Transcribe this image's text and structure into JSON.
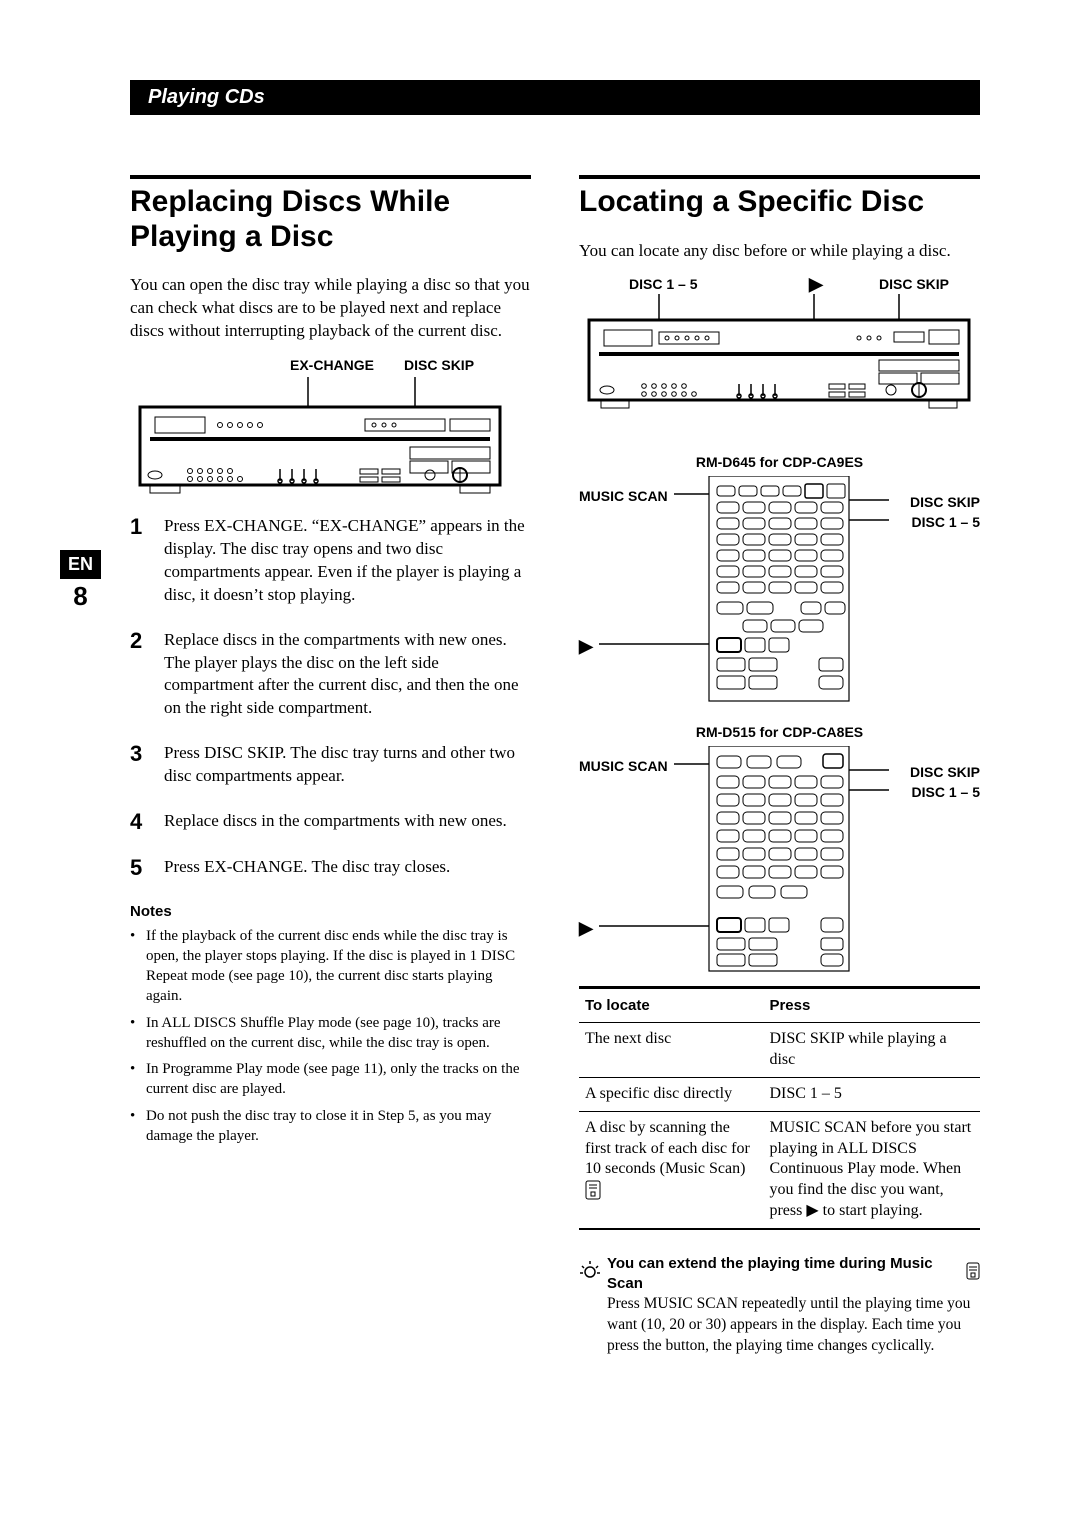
{
  "page": {
    "lang": "EN",
    "number": "8",
    "section": "Playing CDs"
  },
  "left": {
    "title": "Replacing Discs While Playing a Disc",
    "intro": "You can open the disc tray while playing a disc so that you can check what discs are to be played next and replace discs without interrupting playback of the current disc.",
    "labels": {
      "exchange": "EX-CHANGE",
      "discskip": "DISC SKIP"
    },
    "steps": [
      "Press EX-CHANGE.\n“EX-CHANGE” appears in the display. The disc tray opens and two disc compartments appear. Even if the player is playing a disc, it doesn’t stop playing.",
      "Replace discs in the compartments with new ones. The player plays the disc on the left side compartment after the current disc, and then the one on the right side compartment.",
      "Press DISC SKIP.\nThe disc tray turns and other two disc compartments appear.",
      "Replace discs in the compartments with new ones.",
      "Press EX-CHANGE.\nThe disc tray closes."
    ],
    "notesHead": "Notes",
    "notes": [
      "If the playback of the current disc ends while the disc tray is open, the player stops playing. If the disc is played in 1 DISC Repeat mode (see page 10), the current disc starts playing again.",
      "In ALL DISCS Shuffle Play mode (see page 10), tracks are reshuffled on the current disc, while the disc tray is open.",
      "In Programme Play mode (see page 11), only the tracks on the current disc are played.",
      "Do not push the disc tray to close it in Step 5, as you may damage the player."
    ]
  },
  "right": {
    "title": "Locating a Specific Disc",
    "intro": "You can locate any disc before or while playing a disc.",
    "deviceLabels": {
      "disc15": "DISC 1 – 5",
      "play": "▶",
      "discskip": "DISC SKIP"
    },
    "remotes": [
      {
        "title": "RM-D645 for CDP-CA9ES",
        "left": {
          "musicscan": "MUSIC SCAN",
          "play": "▶"
        },
        "right": {
          "discskip": "DISC SKIP",
          "disc15": "DISC 1 – 5"
        }
      },
      {
        "title": "RM-D515 for CDP-CA8ES",
        "left": {
          "musicscan": "MUSIC SCAN",
          "play": "▶"
        },
        "right": {
          "discskip": "DISC SKIP",
          "disc15": "DISC 1 – 5"
        }
      }
    ],
    "table": {
      "headers": {
        "tolocate": "To locate",
        "press": "Press"
      },
      "rows": [
        {
          "tolocate": "The next disc",
          "press": "DISC SKIP while playing a disc"
        },
        {
          "tolocate": "A specific disc directly",
          "press": "DISC 1 – 5"
        },
        {
          "tolocate": "A disc by scanning the first track of each disc for 10 seconds (Music Scan)",
          "press": "MUSIC SCAN before you start playing in ALL DISCS Continuous Play mode. When you find the disc you want, press ▶ to start playing."
        }
      ]
    },
    "tip": {
      "head": "You can extend the playing time during Music Scan",
      "body": "Press MUSIC SCAN repeatedly until the playing time you want (10, 20 or 30) appears in the display. Each time you press the button, the playing time changes cyclically."
    }
  }
}
